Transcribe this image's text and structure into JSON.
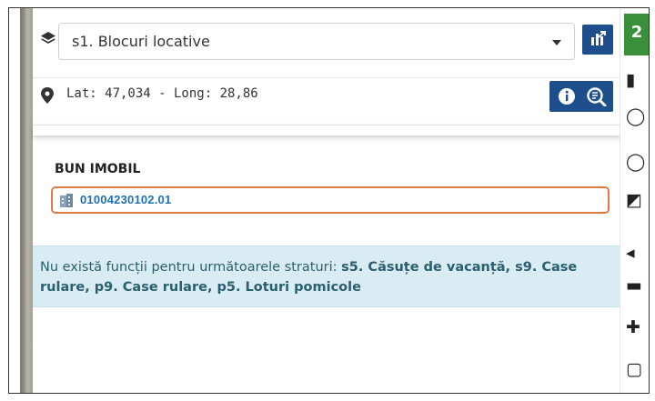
{
  "layer_select": {
    "value": "s1. Blocuri locative"
  },
  "location": {
    "coords": "Lat: 47,034 - Long: 28,86"
  },
  "result": {
    "section_title": "BUN IMOBIL",
    "item_id": "01004230102.01"
  },
  "info": {
    "prefix": "Nu există funcții pentru următoarele straturi: ",
    "layers": "s5. Căsuțe de vacanță, s9. Case rulare, p9. Case rulare, p5. Loturi pomicole"
  },
  "colors": {
    "accent_blue": "#1f4e8c",
    "link_blue": "#1f6fb5",
    "highlight_orange": "#e07a45",
    "info_bg": "#d9ecf3",
    "info_text": "#2b5f6f",
    "toolbar_green": "#3a8f3a"
  },
  "icons": {
    "layers": "layers-icon",
    "select_caret": "chevron-down-icon",
    "chart": "chart-icon",
    "pin": "map-pin-icon",
    "info": "info-icon",
    "zoom": "zoom-extent-icon",
    "building": "building-icon"
  }
}
